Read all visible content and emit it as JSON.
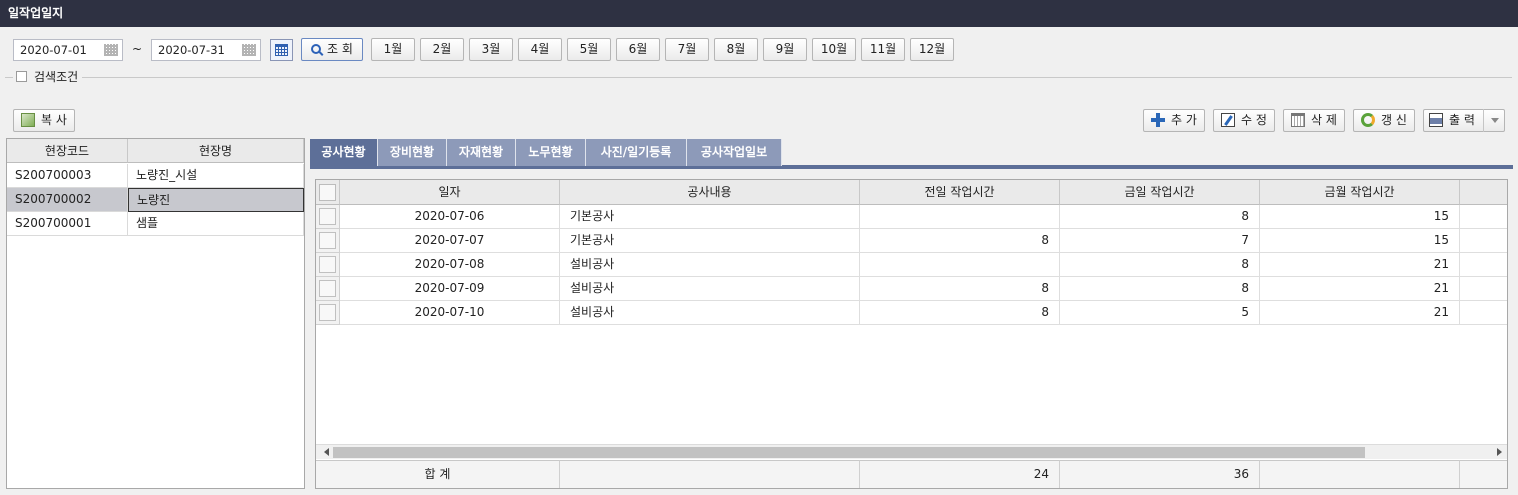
{
  "window": {
    "title": "일작업일지"
  },
  "filter": {
    "date_from": "2020-07-01",
    "tilde": "~",
    "date_to": "2020-07-31",
    "search_label": "조 회",
    "months": [
      "1월",
      "2월",
      "3월",
      "4월",
      "5월",
      "6월",
      "7월",
      "8월",
      "9월",
      "10월",
      "11월",
      "12월"
    ],
    "condition_label": "검색조건"
  },
  "toolbar": {
    "copy_label": "복 사",
    "add_label": "추 가",
    "edit_label": "수 정",
    "delete_label": "삭 제",
    "refresh_label": "갱 신",
    "print_label": "출 력"
  },
  "site_list": {
    "headers": [
      "현장코드",
      "현장명"
    ],
    "rows": [
      {
        "code": "S200700003",
        "name": "노량진_시설"
      },
      {
        "code": "S200700002",
        "name": "노량진"
      },
      {
        "code": "S200700001",
        "name": "샘플"
      }
    ]
  },
  "tabs": [
    "공사현황",
    "장비현황",
    "자재현황",
    "노무현황",
    "사진/일기등록",
    "공사작업일보"
  ],
  "work_grid": {
    "headers": [
      "일자",
      "공사내용",
      "전일 작업시간",
      "금일 작업시간",
      "금월 작업시간"
    ],
    "rows": [
      {
        "date": "2020-07-06",
        "content": "기본공사",
        "prev": "",
        "today": "8",
        "month": "15"
      },
      {
        "date": "2020-07-07",
        "content": "기본공사",
        "prev": "8",
        "today": "7",
        "month": "15"
      },
      {
        "date": "2020-07-08",
        "content": "설비공사",
        "prev": "",
        "today": "8",
        "month": "21"
      },
      {
        "date": "2020-07-09",
        "content": "설비공사",
        "prev": "8",
        "today": "8",
        "month": "21"
      },
      {
        "date": "2020-07-10",
        "content": "설비공사",
        "prev": "8",
        "today": "5",
        "month": "21"
      }
    ],
    "total_label": "합 계",
    "total_prev": "24",
    "total_today": "36"
  },
  "icons": {
    "calendar": "calendar-icon",
    "search": "search-icon",
    "copy": "copy-icon",
    "add": "plus-icon",
    "edit": "edit-icon",
    "delete": "trash-icon",
    "refresh": "refresh-icon",
    "print": "printer-icon"
  },
  "colors": {
    "titlebar": "#2e3142",
    "tab_active": "#5d6f98",
    "tab_inactive": "#8d9ab9",
    "selected_row": "#c7c8ce"
  }
}
